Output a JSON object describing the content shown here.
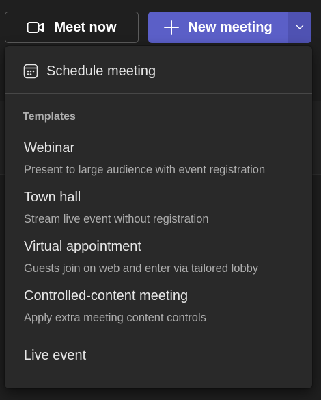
{
  "toolbar": {
    "meet_now_label": "Meet now",
    "new_meeting_label": "New meeting",
    "meet_now_icon": "video-camera-icon",
    "new_meeting_icon": "plus-icon",
    "dropdown_icon": "chevron-down-icon",
    "accent_color": "#5b5fc7"
  },
  "menu": {
    "schedule": {
      "label": "Schedule meeting",
      "icon": "calendar-icon"
    },
    "templates_heading": "Templates",
    "templates": [
      {
        "title": "Webinar",
        "description": "Present to large audience with event registration"
      },
      {
        "title": "Town hall",
        "description": "Stream live event without registration"
      },
      {
        "title": "Virtual appointment",
        "description": "Guests join on web and enter via tailored lobby"
      },
      {
        "title": "Controlled-content meeting",
        "description": "Apply extra meeting content controls"
      },
      {
        "title": "Live event"
      }
    ]
  }
}
